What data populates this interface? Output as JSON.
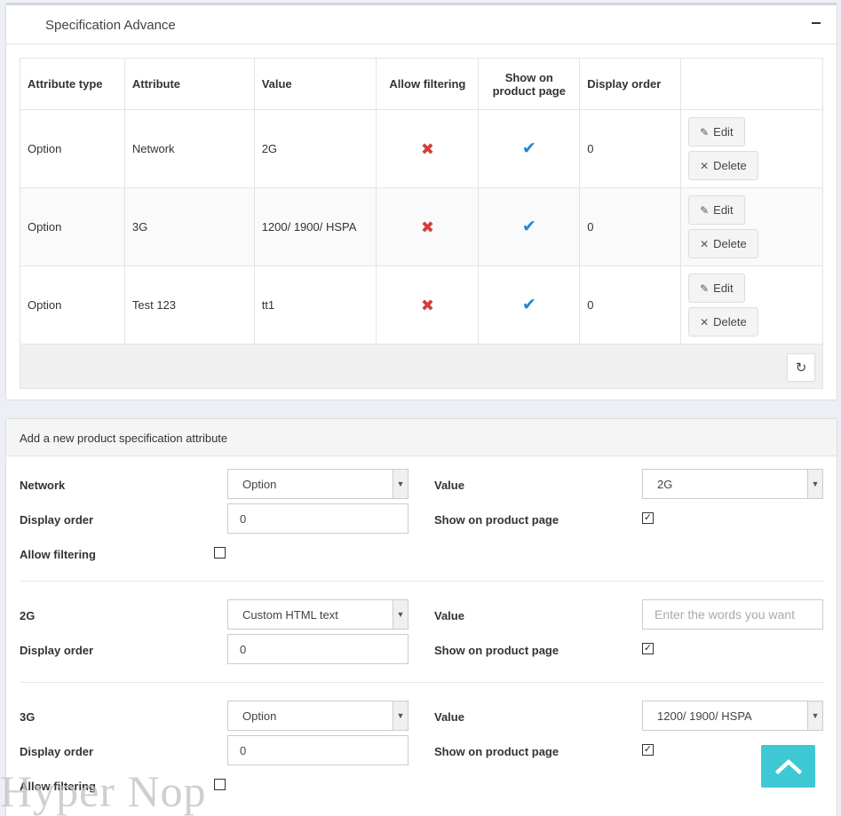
{
  "spec_panel": {
    "title": "Specification Advance",
    "columns": [
      "Attribute type",
      "Attribute",
      "Value",
      "Allow filtering",
      "Show on product page",
      "Display order"
    ],
    "rows": [
      {
        "type": "Option",
        "attribute": "Network",
        "value": "2G",
        "display_order": "0"
      },
      {
        "type": "Option",
        "attribute": "3G",
        "value": "1200/ 1900/ HSPA",
        "display_order": "0"
      },
      {
        "type": "Option",
        "attribute": "Test 123",
        "value": "tt1",
        "display_order": "0"
      }
    ],
    "edit_label": "Edit",
    "delete_label": "Delete"
  },
  "add_panel": {
    "title": "Add a new product specification attribute",
    "groups": [
      {
        "name": "Network",
        "type_selected": "Option",
        "value_label": "Value",
        "value_selected": "2G",
        "display_order_label": "Display order",
        "display_order": "0",
        "show_label": "Show on product page",
        "allow_label": "Allow filtering"
      },
      {
        "name": "2G",
        "type_selected": "Custom HTML text",
        "value_label": "Value",
        "value_placeholder": "Enter the words you want",
        "display_order_label": "Display order",
        "display_order": "0",
        "show_label": "Show on product page"
      },
      {
        "name": "3G",
        "type_selected": "Option",
        "value_label": "Value",
        "value_selected": "1200/ 1900/ HSPA",
        "display_order_label": "Display order",
        "display_order": "0",
        "show_label": "Show on product page",
        "allow_label": "Allow filtering"
      }
    ]
  },
  "watermark": "Hyper Nop",
  "colors": {
    "accent": "#3ec8d3",
    "cross": "#d43f3a",
    "check": "#1e88d4"
  }
}
